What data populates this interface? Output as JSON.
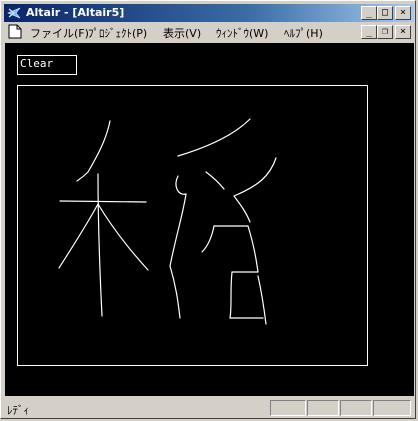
{
  "window": {
    "title": "Altair - [Altair5]"
  },
  "titlebar_buttons": {
    "minimize": "_",
    "maximize": "□",
    "close": "×"
  },
  "menu": [
    "ファイル(F)",
    "ﾌﾟﾛｼﾞｪｸﾄ(P)",
    "表示(V)",
    "ｳｨﾝﾄﾞｳ(W)",
    "ﾍﾙﾌﾟ(H)"
  ],
  "mdi_buttons": {
    "minimize": "_",
    "restore": "❐",
    "close": "×"
  },
  "app": {
    "clear_label": "Clear"
  },
  "status": {
    "text": "ﾚﾃﾞｨ"
  },
  "colors": {
    "title_start": "#0a246a",
    "title_end": "#a6caf0",
    "canvas_bg": "#000000",
    "stroke": "#ffffff"
  }
}
